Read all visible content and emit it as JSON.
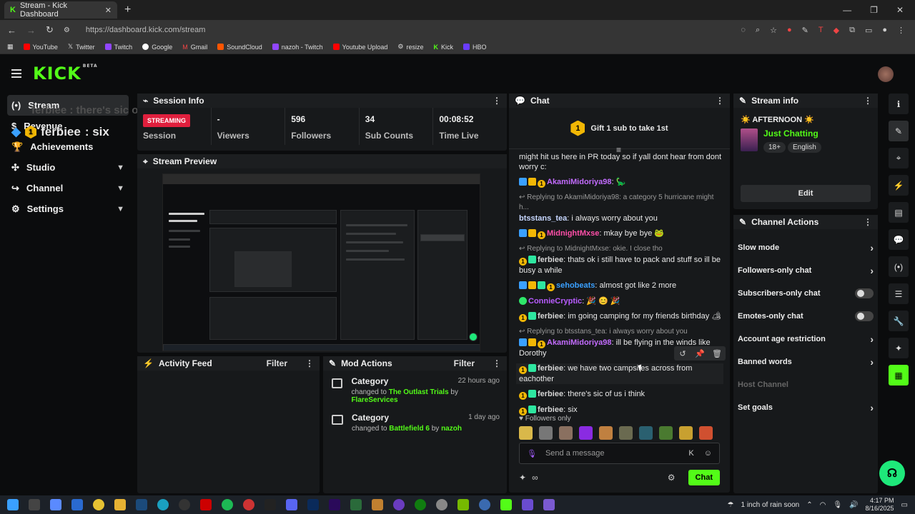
{
  "browser": {
    "tab_title": "Stream - Kick Dashboard",
    "url": "https://dashboard.kick.com/stream",
    "bookmarks": [
      "YouTube",
      "Twitter",
      "Twitch",
      "Google",
      "Gmail",
      "SoundCloud",
      "nazoh - Twitch",
      "Youtube Upload",
      "resize",
      "Kick",
      "HBO"
    ]
  },
  "header": {
    "logo": "KICK",
    "logo_tag": "BETA"
  },
  "sidebar": {
    "items": [
      {
        "label": "Stream",
        "icon": "broadcast-icon"
      },
      {
        "label": "Revenue",
        "icon": "dollar-icon"
      },
      {
        "label": "Achievements",
        "icon": "trophy-icon"
      },
      {
        "label": "Studio",
        "icon": "studio-icon"
      },
      {
        "label": "Channel",
        "icon": "channel-icon"
      },
      {
        "label": "Settings",
        "icon": "gear-icon"
      }
    ]
  },
  "overlay": {
    "faded_text": "ferbiee : there's sic of us i think",
    "msg_user": "ferbiee",
    "msg_text": " : six",
    "badge": "1"
  },
  "session": {
    "title": "Session Info",
    "status": "STREAMING",
    "stats": [
      {
        "value": "",
        "label": "Session"
      },
      {
        "value": "-",
        "label": "Viewers"
      },
      {
        "value": "596",
        "label": "Followers"
      },
      {
        "value": "34",
        "label": "Sub Counts"
      },
      {
        "value": "00:08:52",
        "label": "Time Live"
      }
    ]
  },
  "preview": {
    "title": "Stream Preview"
  },
  "activity": {
    "title": "Activity Feed",
    "filter": "Filter"
  },
  "mod": {
    "title": "Mod Actions",
    "filter": "Filter",
    "items": [
      {
        "title": "Category",
        "prefix": "changed to ",
        "target": "The Outlast Trials",
        "by": " by ",
        "user": "FlareServices",
        "time": "22 hours ago"
      },
      {
        "title": "Category",
        "prefix": "changed to ",
        "target": "Battlefield 6",
        "by": " by ",
        "user": "nazoh",
        "time": "1 day ago"
      }
    ]
  },
  "chat": {
    "title": "Chat",
    "gift_badge": "1",
    "gift_text": "Gift 1 sub to take 1st",
    "messages": [
      {
        "reply": "",
        "user": "",
        "color": "#e8e8e8",
        "text": "might hit us here in PR today so if yall dont hear from dont worry c:"
      },
      {
        "reply": "",
        "user": "AkamiMidoriya98",
        "color": "#c36cff",
        "text": ": 🦕"
      },
      {
        "reply": "↩ Replying to AkamiMidoriya98: a category 5 hurricane might h...",
        "user": "btsstans_tea",
        "color": "#c6d6ff",
        "text": ": i always worry about you"
      },
      {
        "reply": "",
        "user": "MidnightMxse",
        "color": "#ff4fa8",
        "text": ": mkay bye bye 🐸"
      },
      {
        "reply": "↩ Replying to MidnightMxse: okie. I close tho",
        "user": "ferbiee",
        "color": "#d6d6d6",
        "text": ": thats ok i still have to pack and stuff so ill be busy a while"
      },
      {
        "reply": "",
        "user": "sehobeats",
        "color": "#3aa0ff",
        "text": ": almost got like 2 more"
      },
      {
        "reply": "",
        "user": "ConnieCryptic",
        "color": "#b85cff",
        "text": ": 🎉 😊 🎉"
      },
      {
        "reply": "",
        "user": "ferbiee",
        "color": "#d6d6d6",
        "text": ": im going camping for my friends birthday 🏕"
      },
      {
        "reply": "↩ Replying to btsstans_tea: i always worry about you",
        "user": "AkamiMidoriya98",
        "color": "#c36cff",
        "text": ": ill be flying in the winds like Dorothy"
      },
      {
        "reply": "",
        "user": "ferbiee",
        "color": "#d6d6d6",
        "text": ": we have two campsites across from eachother"
      },
      {
        "reply": "",
        "user": "ferbiee",
        "color": "#d6d6d6",
        "text": ": there's sic of us i think"
      },
      {
        "reply": "",
        "user": "ferbiee",
        "color": "#d6d6d6",
        "text": ": six"
      }
    ],
    "followers_only": "♥ Followers only",
    "input_placeholder": "Send a message",
    "send_label": "Chat"
  },
  "stream_info": {
    "title": "Stream info",
    "stream_title": "☀️ AFTERNOON ☀️",
    "category": "Just Chatting",
    "tags": [
      "18+",
      "English"
    ],
    "edit_label": "Edit"
  },
  "channel_actions": {
    "title": "Channel Actions",
    "items": [
      {
        "label": "Slow mode",
        "kind": "arrow"
      },
      {
        "label": "Followers-only chat",
        "kind": "arrow"
      },
      {
        "label": "Subscribers-only chat",
        "kind": "toggle"
      },
      {
        "label": "Emotes-only chat",
        "kind": "toggle"
      },
      {
        "label": "Account age restriction",
        "kind": "arrow"
      },
      {
        "label": "Banned words",
        "kind": "arrow"
      },
      {
        "label": "Host Channel",
        "kind": "disabled"
      },
      {
        "label": "Set goals",
        "kind": "arrow"
      }
    ]
  },
  "taskbar": {
    "weather": "1 inch of rain soon",
    "time": "4:17 PM",
    "date": "8/16/2025"
  },
  "colors": {
    "accent": "#53fc18",
    "live": "#e01f3d",
    "panel": "#17191b"
  }
}
